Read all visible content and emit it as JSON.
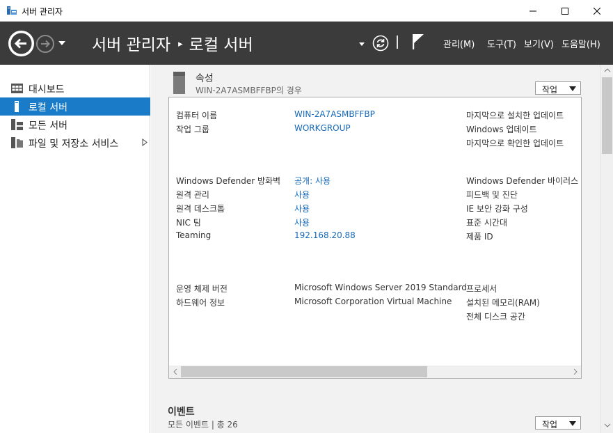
{
  "window": {
    "title": "서버 관리자"
  },
  "commandbar": {
    "breadcrumb_root": "서버 관리자",
    "breadcrumb_separator": "▸",
    "breadcrumb_current": "로컬 서버",
    "menus": {
      "manage": "관리(M)",
      "tools": "도구(T)",
      "view": "보기(V)",
      "help": "도움말(H)"
    }
  },
  "sidebar": {
    "items": [
      {
        "label": "대시보드",
        "icon": "dashboard-icon",
        "active": false
      },
      {
        "label": "로컬 서버",
        "icon": "local-server-icon",
        "active": true
      },
      {
        "label": "모든 서버",
        "icon": "all-servers-icon",
        "active": false
      },
      {
        "label": "파일 및 저장소 서비스",
        "icon": "file-storage-icon",
        "active": false,
        "has_submenu": true
      }
    ]
  },
  "properties": {
    "title": "속성",
    "subtitle": "WIN-2A7ASMBFFBP의 경우",
    "task_label": "작업",
    "left_rows": [
      {
        "label": "컴퓨터 이름",
        "value": "WIN-2A7ASMBFFBP",
        "link": true
      },
      {
        "label": "작업 그룹",
        "value": "WORKGROUP",
        "link": true
      },
      {
        "label": "Windows Defender 방화벽",
        "value": "공개: 사용",
        "link": true
      },
      {
        "label": "원격 관리",
        "value": "사용",
        "link": true
      },
      {
        "label": "원격 데스크톱",
        "value": "사용",
        "link": true
      },
      {
        "label": "NIC 팀",
        "value": "사용",
        "link": true
      },
      {
        "label": "Teaming",
        "value": "192.168.20.88",
        "link": true
      },
      {
        "label": "운영 체제 버전",
        "value": "Microsoft Windows Server 2019 Standard",
        "link": false
      },
      {
        "label": "하드웨어 정보",
        "value": "Microsoft Corporation Virtual Machine",
        "link": false
      }
    ],
    "right_rows": [
      "마지막으로 설치한 업데이트",
      "Windows 업데이트",
      "마지막으로 확인한 업데이트",
      "Windows Defender 바이러스 백",
      "피드백 및 진단",
      "IE 보안 강화 구성",
      "표준 시간대",
      "제품 ID",
      "프로세서",
      "설치된 메모리(RAM)",
      "전체 디스크 공간"
    ]
  },
  "events": {
    "title": "이벤트",
    "subtitle": "모든 이벤트 | 총 26",
    "task_label": "작업"
  },
  "colors": {
    "accent": "#1a7bc9",
    "commandbar_bg": "#3b3b3b",
    "link": "#1668b8"
  }
}
